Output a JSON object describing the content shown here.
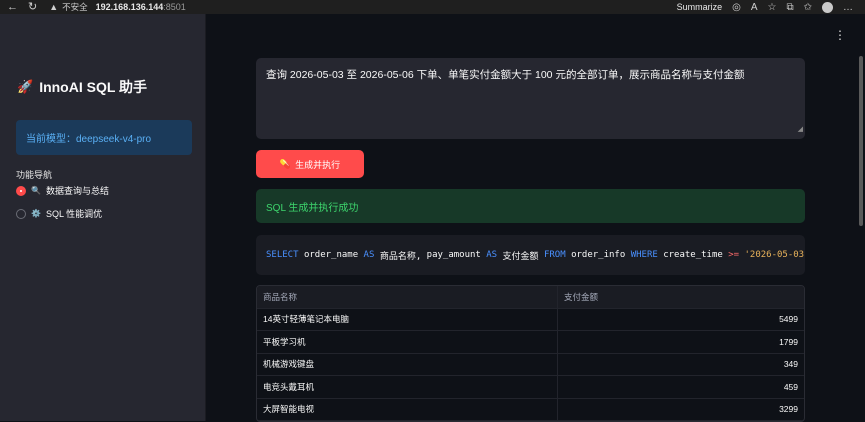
{
  "browser": {
    "insecure_label": "不安全",
    "host": "192.168.136.144",
    "port": ":8501",
    "summarize_label": "Summarize"
  },
  "sidebar": {
    "title": "InnoAI SQL 助手",
    "model_label": "当前模型：deepseek-v4-pro",
    "nav_label": "功能导航",
    "nav_items": [
      {
        "label": "数据查询与总结",
        "selected": true
      },
      {
        "label": "SQL 性能调优",
        "selected": false
      }
    ]
  },
  "main": {
    "query_text": "查询 2026-05-03 至 2026-05-06 下单、单笔实付金额大于 100 元的全部订单，展示商品名称与支付金额",
    "run_button_label": "生成并执行",
    "success_message": "SQL 生成并执行成功",
    "sql": {
      "select": "SELECT",
      "col1": "order_name",
      "as1": "AS",
      "alias1": "商品名称,",
      "col2": "pay_amount",
      "as2": "AS",
      "alias2": "支付金额",
      "from": "FROM",
      "table": "order_info",
      "where": "WHERE",
      "cond_col": "create_time",
      "cond_op": ">=",
      "cond_val": "'2026-05-03'"
    },
    "table": {
      "columns": [
        "商品名称",
        "支付金额"
      ],
      "rows": [
        {
          "name": "14英寸轻薄笔记本电脑",
          "amount": "5499"
        },
        {
          "name": "平板学习机",
          "amount": "1799"
        },
        {
          "name": "机械游戏键盘",
          "amount": "349"
        },
        {
          "name": "电竞头戴耳机",
          "amount": "459"
        },
        {
          "name": "大屏智能电视",
          "amount": "3299"
        }
      ]
    }
  },
  "colors": {
    "accent": "#ff4b4b",
    "success_bg": "#173928",
    "success_text": "#3dd56d",
    "info_bg": "#1b3a5a",
    "info_text": "#5ab0f5"
  }
}
